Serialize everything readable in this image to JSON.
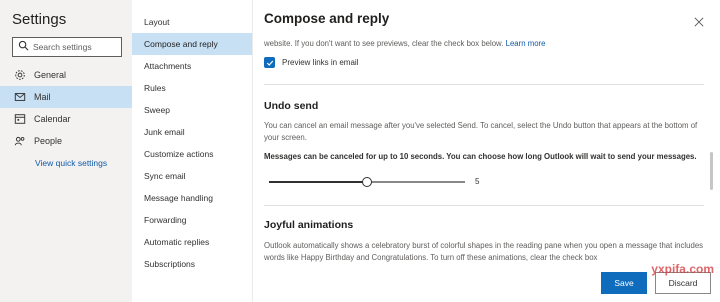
{
  "left": {
    "title": "Settings",
    "search_placeholder": "Search settings",
    "items": [
      {
        "label": "General",
        "icon": "gear-icon"
      },
      {
        "label": "Mail",
        "icon": "mail-icon"
      },
      {
        "label": "Calendar",
        "icon": "calendar-icon"
      },
      {
        "label": "People",
        "icon": "people-icon"
      }
    ],
    "quick_link": "View quick settings"
  },
  "mid": {
    "items": [
      "Layout",
      "Compose and reply",
      "Attachments",
      "Rules",
      "Sweep",
      "Junk email",
      "Customize actions",
      "Sync email",
      "Message handling",
      "Forwarding",
      "Automatic replies",
      "Subscriptions"
    ]
  },
  "content": {
    "title": "Compose and reply",
    "preview_text": "website. If you don't want to see previews, clear the check box below.",
    "learn_more": "Learn more",
    "preview_checkbox": "Preview links in email",
    "undo_title": "Undo send",
    "undo_desc": "You can cancel an email message after you've selected Send. To cancel, select the Undo button that appears at the bottom of your screen.",
    "undo_bold": "Messages can be canceled for up to 10 seconds. You can choose how long Outlook will wait to send your messages.",
    "slider_value": "5",
    "slider_fraction": 0.5,
    "joyful_title": "Joyful animations",
    "joyful_desc": "Outlook automatically shows a celebratory burst of colorful shapes in the reading pane when you open a message that includes words like Happy Birthday and Congratulations. To turn off these animations, clear the check box",
    "save_label": "Save",
    "discard_label": "Discard"
  },
  "watermark": "yxpifa.com",
  "colors": {
    "accent": "#0f6cbd",
    "selected": "#c7e0f4",
    "link": "#0f5aa8"
  }
}
